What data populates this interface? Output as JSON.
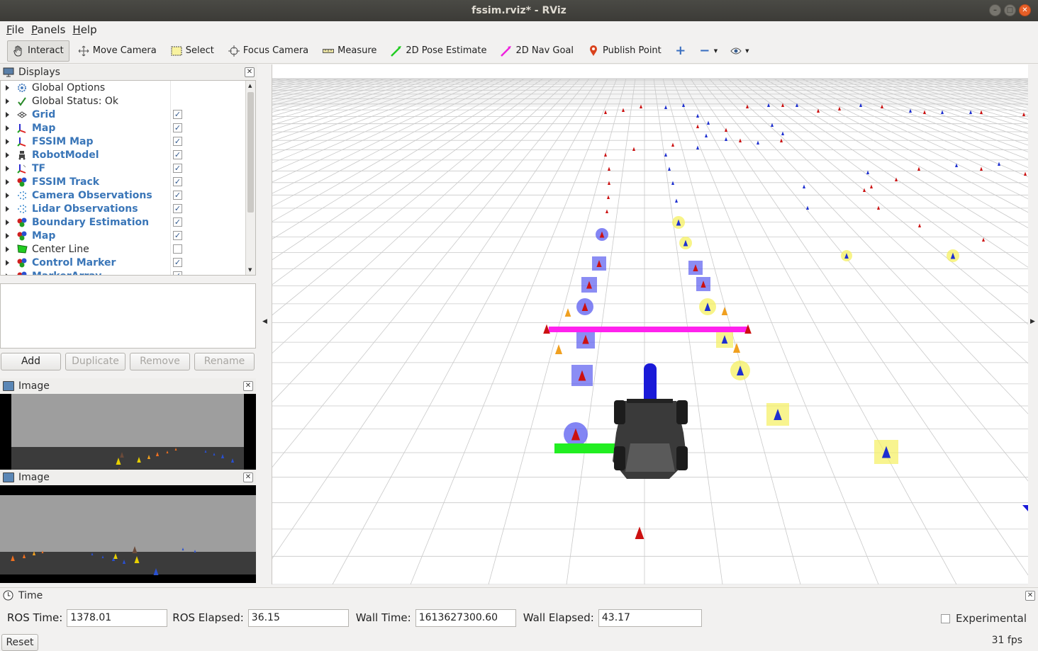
{
  "window": {
    "title": "fssim.rviz* - RViz"
  },
  "menu": [
    {
      "label": "File",
      "accel": "F",
      "rest": "ile"
    },
    {
      "label": "Panels",
      "accel": "P",
      "rest": "anels"
    },
    {
      "label": "Help",
      "accel": "H",
      "rest": "elp"
    }
  ],
  "toolbar": {
    "tools": [
      {
        "label": "Interact",
        "icon": "hand-icon",
        "active": true
      },
      {
        "label": "Move Camera",
        "icon": "move-camera-icon"
      },
      {
        "label": "Select",
        "icon": "select-icon"
      },
      {
        "label": "Focus Camera",
        "icon": "focus-camera-icon"
      },
      {
        "label": "Measure",
        "icon": "measure-icon"
      },
      {
        "label": "2D Pose Estimate",
        "icon": "pose-estimate-icon"
      },
      {
        "label": "2D Nav Goal",
        "icon": "nav-goal-icon"
      },
      {
        "label": "Publish Point",
        "icon": "publish-point-icon"
      }
    ]
  },
  "displays": {
    "title": "Displays",
    "items": [
      {
        "label": "Global Options",
        "icon": "gear-icon",
        "bold": false,
        "checked": null
      },
      {
        "label": "Global Status: Ok",
        "icon": "checkmark-icon",
        "bold": false,
        "checked": null
      },
      {
        "label": "Grid",
        "icon": "grid-icon",
        "bold": true,
        "checked": true
      },
      {
        "label": "Map",
        "icon": "map-axes-icon",
        "bold": true,
        "checked": true
      },
      {
        "label": "FSSIM Map",
        "icon": "map-axes-icon",
        "bold": true,
        "checked": true
      },
      {
        "label": "RobotModel",
        "icon": "robot-icon",
        "bold": true,
        "checked": true
      },
      {
        "label": "TF",
        "icon": "tf-icon",
        "bold": true,
        "checked": true
      },
      {
        "label": "FSSIM Track",
        "icon": "marker-icon",
        "bold": true,
        "checked": true
      },
      {
        "label": "Camera Observations",
        "icon": "pointcloud-icon",
        "bold": true,
        "checked": true
      },
      {
        "label": "Lidar Observations",
        "icon": "pointcloud-icon",
        "bold": true,
        "checked": true
      },
      {
        "label": "Boundary Estimation",
        "icon": "marker-icon",
        "bold": true,
        "checked": true
      },
      {
        "label": "Map",
        "icon": "marker-icon",
        "bold": true,
        "checked": true
      },
      {
        "label": "Center Line",
        "icon": "polygon-icon",
        "bold": false,
        "checked": false
      },
      {
        "label": "Control Marker",
        "icon": "marker-icon",
        "bold": true,
        "checked": true
      },
      {
        "label": "MarkerArray",
        "icon": "marker-icon",
        "bold": true,
        "checked": true
      }
    ],
    "buttons": [
      {
        "label": "Add",
        "enabled": true
      },
      {
        "label": "Duplicate",
        "enabled": false
      },
      {
        "label": "Remove",
        "enabled": false
      },
      {
        "label": "Rename",
        "enabled": false
      }
    ]
  },
  "image_panels": [
    {
      "title": "Image"
    },
    {
      "title": "Image"
    }
  ],
  "time": {
    "title": "Time",
    "ros_time_label": "ROS Time:",
    "ros_time": "1378.01",
    "ros_elapsed_label": "ROS Elapsed:",
    "ros_elapsed": "36.15",
    "wall_time_label": "Wall Time:",
    "wall_time": "1613627300.60",
    "wall_elapsed_label": "Wall Elapsed:",
    "wall_elapsed": "43.17",
    "experimental_label": "Experimental",
    "reset_label": "Reset",
    "fps": "31 fps"
  },
  "colors": {
    "accent": "#3a76b8",
    "cone_red": "#cc1111",
    "cone_blue": "#1d2fd0",
    "cone_orange": "#f0a020",
    "highlight_yellow": "#f5f060",
    "highlight_blue": "#5a5cf0",
    "boundary_magenta": "#ff22ee",
    "axis_green": "#22ee22"
  }
}
